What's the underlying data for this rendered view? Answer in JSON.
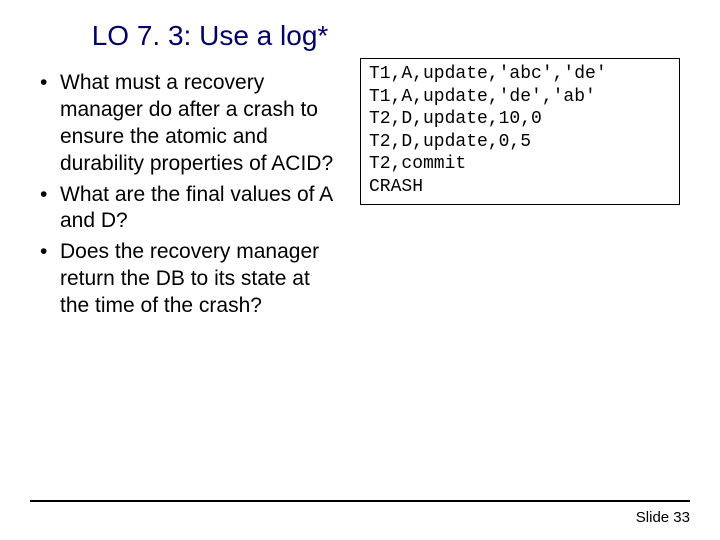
{
  "title": "LO 7. 3: Use a log*",
  "bullets": [
    "What must a recovery manager do after a crash to ensure the atomic and durability properties of ACID?",
    "What are the final values of A and D?",
    "Does the recovery manager return the DB to its state at the time of the crash?"
  ],
  "log_lines": [
    "T1,A,update,'abc','de'",
    "T1,A,update,'de','ab'",
    "T2,D,update,10,0",
    "T2,D,update,0,5",
    "T2,commit",
    "CRASH"
  ],
  "footer": "Slide 33"
}
